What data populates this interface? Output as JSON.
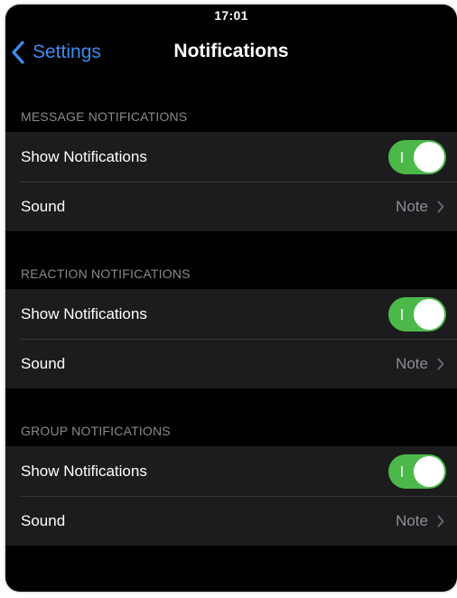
{
  "status_bar": {
    "time": "17:01"
  },
  "nav": {
    "back_label": "Settings",
    "title": "Notifications"
  },
  "colors": {
    "accent": "#3b8cf0",
    "toggle_on": "#4cb84a"
  },
  "sections": [
    {
      "header": "MESSAGE NOTIFICATIONS",
      "rows": [
        {
          "label": "Show Notifications",
          "toggle": true
        },
        {
          "label": "Sound",
          "value": "Note"
        }
      ]
    },
    {
      "header": "REACTION NOTIFICATIONS",
      "rows": [
        {
          "label": "Show Notifications",
          "toggle": true
        },
        {
          "label": "Sound",
          "value": "Note"
        }
      ]
    },
    {
      "header": "GROUP NOTIFICATIONS",
      "rows": [
        {
          "label": "Show Notifications",
          "toggle": true
        },
        {
          "label": "Sound",
          "value": "Note"
        }
      ]
    }
  ]
}
